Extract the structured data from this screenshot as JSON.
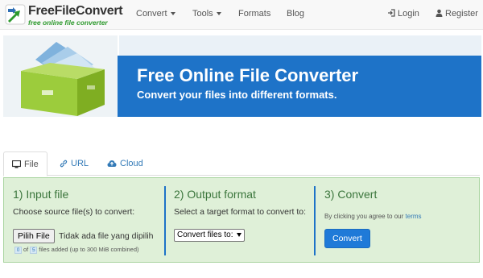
{
  "brand": {
    "name": "FreeFileConvert",
    "tagline": "free online file converter"
  },
  "nav": {
    "links": [
      {
        "label": "Convert",
        "has_dropdown": true
      },
      {
        "label": "Tools",
        "has_dropdown": true
      },
      {
        "label": "Formats",
        "has_dropdown": false
      },
      {
        "label": "Blog",
        "has_dropdown": false
      }
    ],
    "login": {
      "label": "Login",
      "icon": "sign-in-icon"
    },
    "register": {
      "label": "Register",
      "icon": "user-icon"
    }
  },
  "hero": {
    "title": "Free Online File Converter",
    "subtitle": "Convert your files into different formats.",
    "image_icon": "file-box-illustration",
    "band_color": "#1e73c8"
  },
  "tabs": [
    {
      "label": "File",
      "icon": "monitor-icon",
      "active": true
    },
    {
      "label": "URL",
      "icon": "link-icon",
      "active": false
    },
    {
      "label": "Cloud",
      "icon": "cloud-upload-icon",
      "active": false
    }
  ],
  "steps": {
    "input": {
      "title": "1) Input file",
      "prompt": "Choose source file(s) to convert:",
      "button_label": "Pilih File",
      "status": "Tidak ada file yang dipilih",
      "count_current": "0",
      "count_of": "of",
      "count_max": "5",
      "count_suffix": "files added (up to 300 MiB combined)"
    },
    "output": {
      "title": "2) Output format",
      "prompt": "Select a target format to convert to:",
      "select_value": "Convert files to:"
    },
    "convert": {
      "title": "3) Convert",
      "agree_text": "By clicking you agree to our",
      "terms_label": "terms",
      "button_label": "Convert"
    }
  },
  "colors": {
    "accent": "#1f7ad8",
    "panel_bg": "#dff0d8",
    "panel_title": "#3c763d",
    "logo_green": "#2e9a2e"
  }
}
